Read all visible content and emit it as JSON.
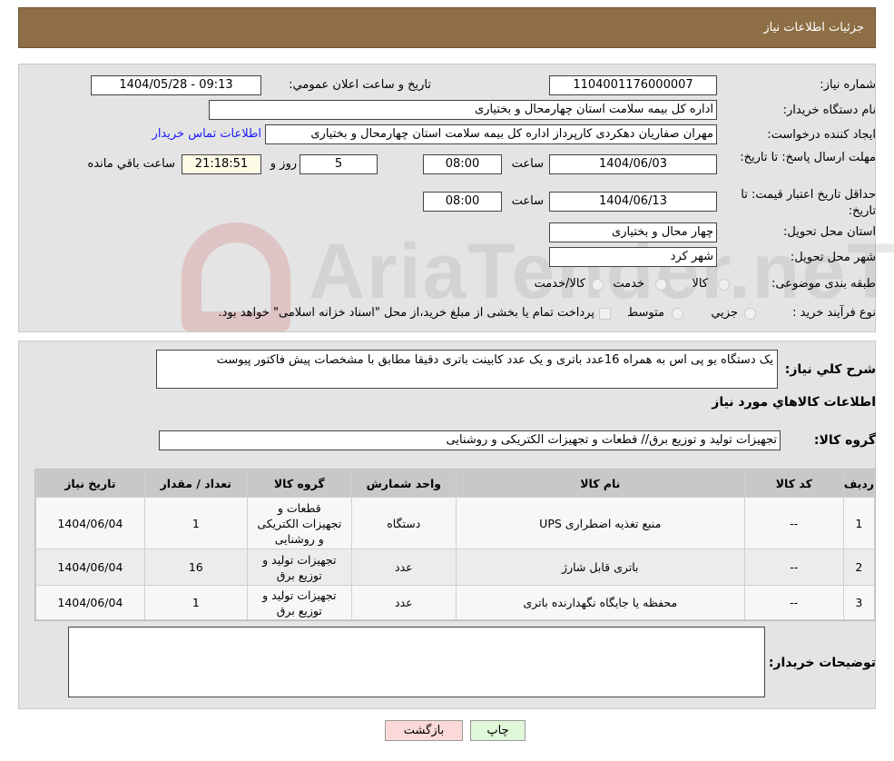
{
  "header": {
    "title": "جزئيات اطلاعات نياز"
  },
  "watermark": "AriaTender.neT",
  "details": {
    "need_number_label": "شماره نياز:",
    "need_number": "1104001176000007",
    "announce_label": "تاريخ و ساعت اعلان عمومي:",
    "announce_value": "1404/05/28 - 09:13",
    "buyer_org_label": "نام دستگاه خريدار:",
    "buyer_org": "اداره کل بیمه سلامت استان چهارمحال و بختیاری",
    "creator_label": "ايجاد کننده درخواست:",
    "creator": "مهران صفاریان دهکردی کارپرداز اداره کل بیمه سلامت استان چهارمحال و بختیاری",
    "contact_link": "اطلاعات تماس خريدار",
    "reply_deadline_label": "مهلت ارسال پاسخ: تا تاريخ:",
    "reply_date": "1404/06/03",
    "time_label": "ساعت",
    "reply_time": "08:00",
    "days": "5",
    "days_label": "روز و",
    "remaining": "21:18:51",
    "remaining_label": "ساعت باقي مانده",
    "price_validity_label": "حداقل تاريخ اعتبار قيمت: تا تاريخ:",
    "price_date": "1404/06/13",
    "price_time": "08:00",
    "province_label": "استان محل تحويل:",
    "province": "چهار محال و بختیاری",
    "city_label": "شهر محل تحويل:",
    "city": "شهر کرد",
    "category_label": "طبقه بندی موضوعی:",
    "category_options": [
      "کالا",
      "خدمت",
      "کالا/خدمت"
    ],
    "process_label": "نوع فرآيند خريد :",
    "process_options": [
      "جزيي",
      "متوسط"
    ],
    "process_note": "پرداخت تمام يا بخشی از مبلغ خريد،از محل \"اسناد خزانه اسلامی\" خواهد بود."
  },
  "summary": {
    "label": "شرح کلي نياز:",
    "text": "یک دستگاه یو پی اس به همراه 16عدد باتری و یک عدد کابینت باتری دقیقا مطابق با مشخصات پیش فاکتور پیوست"
  },
  "goods": {
    "heading": "اطلاعات کالاهاي مورد نياز",
    "group_label": "گروه کالا:",
    "group": "تجهیزات تولید و توزیع برق// قطعات و تجهیزات الکتریکی و روشنایی",
    "columns": [
      "رديف",
      "کد کالا",
      "نام کالا",
      "واحد شمارش",
      "گروه کالا",
      "تعداد / مقدار",
      "تاريخ نياز"
    ],
    "rows": [
      [
        "1",
        "--",
        "منبع تغذیه اضطراری UPS",
        "دستگاه",
        "قطعات و تجهیزات الکتریکی و روشنایی",
        "1",
        "1404/06/04"
      ],
      [
        "2",
        "--",
        "باتری قابل شارژ",
        "عدد",
        "تجهیزات تولید و توزیع برق",
        "16",
        "1404/06/04"
      ],
      [
        "3",
        "--",
        "محفظه یا جایگاه نگهدارنده باتری",
        "عدد",
        "تجهیزات تولید و توزیع برق",
        "1",
        "1404/06/04"
      ]
    ]
  },
  "buyer_notes": {
    "label": "توضيحات خريدار:",
    "text": ""
  },
  "buttons": {
    "back": "بازگشت",
    "print": "چاپ"
  }
}
